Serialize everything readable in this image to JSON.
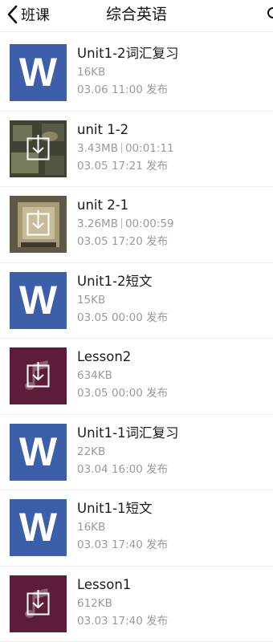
{
  "nav": {
    "back_label": "班课",
    "title": "综合英语"
  },
  "files": [
    {
      "name": "Unit1-2词汇复习",
      "size": "16KB",
      "duration": "",
      "date": "03.06 11:00 发布",
      "type": "word"
    },
    {
      "name": "unit 1-2",
      "size": "3.43MB",
      "duration": "00:01:11",
      "date": "03.05 17:21 发布",
      "type": "video"
    },
    {
      "name": "unit 2-1",
      "size": "3.26MB",
      "duration": "00:00:59",
      "date": "03.05 17:20 发布",
      "type": "video"
    },
    {
      "name": "Unit1-2短文",
      "size": "15KB",
      "duration": "",
      "date": "03.05 00:00 发布",
      "type": "word"
    },
    {
      "name": "Lesson2",
      "size": "634KB",
      "duration": "",
      "date": "03.05 00:00 发布",
      "type": "audio"
    },
    {
      "name": "Unit1-1词汇复习",
      "size": "22KB",
      "duration": "",
      "date": "03.04 16:00 发布",
      "type": "word"
    },
    {
      "name": "Unit1-1短文",
      "size": "16KB",
      "duration": "",
      "date": "03.03 17:40 发布",
      "type": "word"
    },
    {
      "name": "Lesson1",
      "size": "612KB",
      "duration": "",
      "date": "03.03 17:40 发布",
      "type": "audio"
    }
  ],
  "icons": {
    "word_letter": "W"
  },
  "colors": {
    "word_bg": "#3d5ea8",
    "audio_bg": "#5c1c3a",
    "meta_text": "#9a9a9a"
  }
}
